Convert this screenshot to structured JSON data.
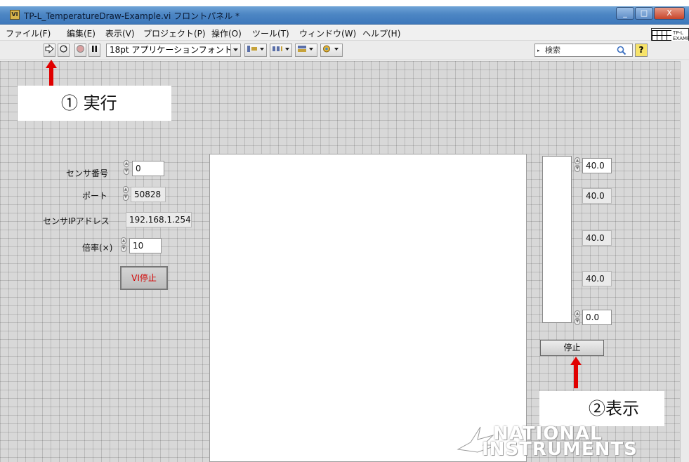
{
  "window": {
    "title": "TP-L_TemperatureDraw-Example.vi フロントパネル *",
    "app_icon_text": "VI",
    "controls": [
      "_",
      "□",
      "X"
    ]
  },
  "menu": [
    "ファイル(F)",
    "編集(E)",
    "表示(V)",
    "プロジェクト(P)",
    "操作(O)",
    "ツール(T)",
    "ウィンドウ(W)",
    "ヘルプ(H)"
  ],
  "toolbar": {
    "font_select": "18pt アプリケーションフォント",
    "search_placeholder": "検索",
    "help_label": "?",
    "vi_icon_label": "TP-L EXAMPLE"
  },
  "callouts": {
    "run": "① 実行",
    "display": "②表示"
  },
  "fields": {
    "sensor_number": {
      "label": "センサ番号",
      "value": "0"
    },
    "port": {
      "label": "ポート",
      "value": "50828"
    },
    "sensor_ip": {
      "label": "センサIPアドレス",
      "value": "192.168.1.254"
    },
    "magnification": {
      "label": "倍率(×)",
      "value": "10"
    }
  },
  "buttons": {
    "vi_stop": "VI停止",
    "stop": "停止"
  },
  "scale": {
    "values": [
      "40.0",
      "40.0",
      "40.0",
      "40.0",
      "0.0"
    ]
  },
  "logo": {
    "line1": "NATIONAL",
    "line2": "INSTRUMENTS"
  },
  "colors": {
    "callout_arrow": "#e00000",
    "vi_stop_text": "#d40000",
    "panel_bg": "#d8d8d8"
  }
}
